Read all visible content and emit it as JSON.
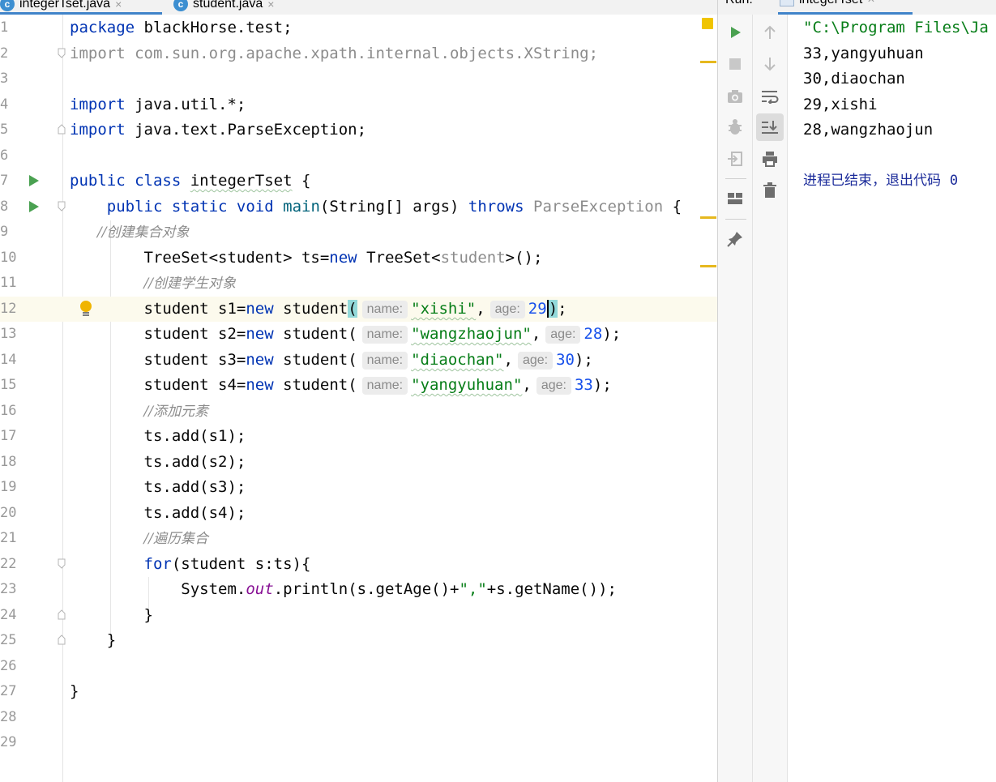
{
  "editor": {
    "tabs": [
      {
        "icon": "c",
        "label": "integerTset.java",
        "close": "×"
      },
      {
        "icon": "c",
        "label": "student.java",
        "close": "×"
      }
    ],
    "lines": [
      {
        "n": "1"
      },
      {
        "n": "2"
      },
      {
        "n": "3"
      },
      {
        "n": "4"
      },
      {
        "n": "5"
      },
      {
        "n": "6"
      },
      {
        "n": "7"
      },
      {
        "n": "8"
      },
      {
        "n": "9"
      },
      {
        "n": "10"
      },
      {
        "n": "11"
      },
      {
        "n": "12"
      },
      {
        "n": "13"
      },
      {
        "n": "14"
      },
      {
        "n": "15"
      },
      {
        "n": "16"
      },
      {
        "n": "17"
      },
      {
        "n": "18"
      },
      {
        "n": "19"
      },
      {
        "n": "20"
      },
      {
        "n": "21"
      },
      {
        "n": "22"
      },
      {
        "n": "23"
      },
      {
        "n": "24"
      },
      {
        "n": "25"
      },
      {
        "n": "26"
      },
      {
        "n": "27"
      },
      {
        "n": "28"
      },
      {
        "n": "29"
      }
    ],
    "code": {
      "l1_kw": "package",
      "l1_rest": " blackHorse.test;",
      "l2": "import com.sun.org.apache.xpath.internal.objects.XString;",
      "l4_kw": "import",
      "l4_rest": " java.util.*;",
      "l5_kw": "import",
      "l5_rest": " java.text.ParseException;",
      "l7_kw": "public class",
      "l7_name": "integerTset",
      "l7_rest": " {",
      "l8_kw1": "public static void",
      "l8_name": "main",
      "l8_mid": "(String[] args) ",
      "l8_kw2": "throws",
      "l8_exc": "ParseException",
      "l8_end": " {",
      "l9": "//创建集合对象",
      "l10_a": "TreeSet<student> ts=",
      "l10_new": "new",
      "l10_b": " TreeSet<",
      "l10_gen": "student",
      "l10_c": ">();",
      "l11": "//创建学生对象",
      "l12_a": "student s1=",
      "l12_new": "new",
      "l12_b": " student",
      "l12_open": "(",
      "l12_hint1": "name:",
      "l12_str": "\"xishi\"",
      "l12_comma": ",",
      "l12_hint2": "age:",
      "l12_num": "29",
      "l12_close": ")",
      "l12_end": ";",
      "l13_a": "student s2=",
      "l13_new": "new",
      "l13_b": " student(",
      "l13_hint1": "name:",
      "l13_str": "\"wangzhaojun\"",
      "l13_comma": ",",
      "l13_hint2": "age:",
      "l13_num": "28",
      "l13_end": ");",
      "l14_a": "student s3=",
      "l14_new": "new",
      "l14_b": " student(",
      "l14_hint1": "name:",
      "l14_str": "\"diaochan\"",
      "l14_comma": ",",
      "l14_hint2": "age:",
      "l14_num": "30",
      "l14_end": ");",
      "l15_a": "student s4=",
      "l15_new": "new",
      "l15_b": " student(",
      "l15_hint1": "name:",
      "l15_str": "\"yangyuhuan\"",
      "l15_comma": ",",
      "l15_hint2": "age:",
      "l15_num": "33",
      "l15_end": ");",
      "l16": "//添加元素",
      "l17": "ts.add(s1);",
      "l18": "ts.add(s2);",
      "l19": "ts.add(s3);",
      "l20": "ts.add(s4);",
      "l21": "//遍历集合",
      "l22_kw": "for",
      "l22_rest": "(student s:ts){",
      "l23_a": "System.",
      "l23_out": "out",
      "l23_b": ".println(s.getAge()+",
      "l23_str": "\",\"",
      "l23_c": "+s.getName());",
      "l24": "}",
      "l25": "}",
      "l27": "}"
    }
  },
  "run_panel": {
    "label": "Run:",
    "tab_label": "integerTset",
    "close": "×",
    "toolbar_left": [
      "rerun-icon",
      "stop-icon",
      "camera-icon",
      "debug-icon",
      "exit-icon",
      "layout-icon",
      "pin-icon"
    ],
    "toolbar_right": [
      "up-arrow-icon",
      "down-arrow-icon",
      "soft-wrap-icon",
      "scroll-to-end-icon",
      "print-icon",
      "trash-icon"
    ],
    "console": {
      "command": "\"C:\\Program Files\\Ja",
      "output": [
        "33,yangyuhuan",
        "30,diaochan",
        "29,xishi",
        "28,wangzhaojun"
      ],
      "exit_text": "进程已结束，退出代码",
      "exit_code": "0"
    }
  },
  "colors": {
    "keyword": "#0033b3",
    "string": "#067d17",
    "number": "#1750eb",
    "comment": "#8c8c8c",
    "run_green": "#4aa151",
    "warning": "#e6b81e"
  }
}
